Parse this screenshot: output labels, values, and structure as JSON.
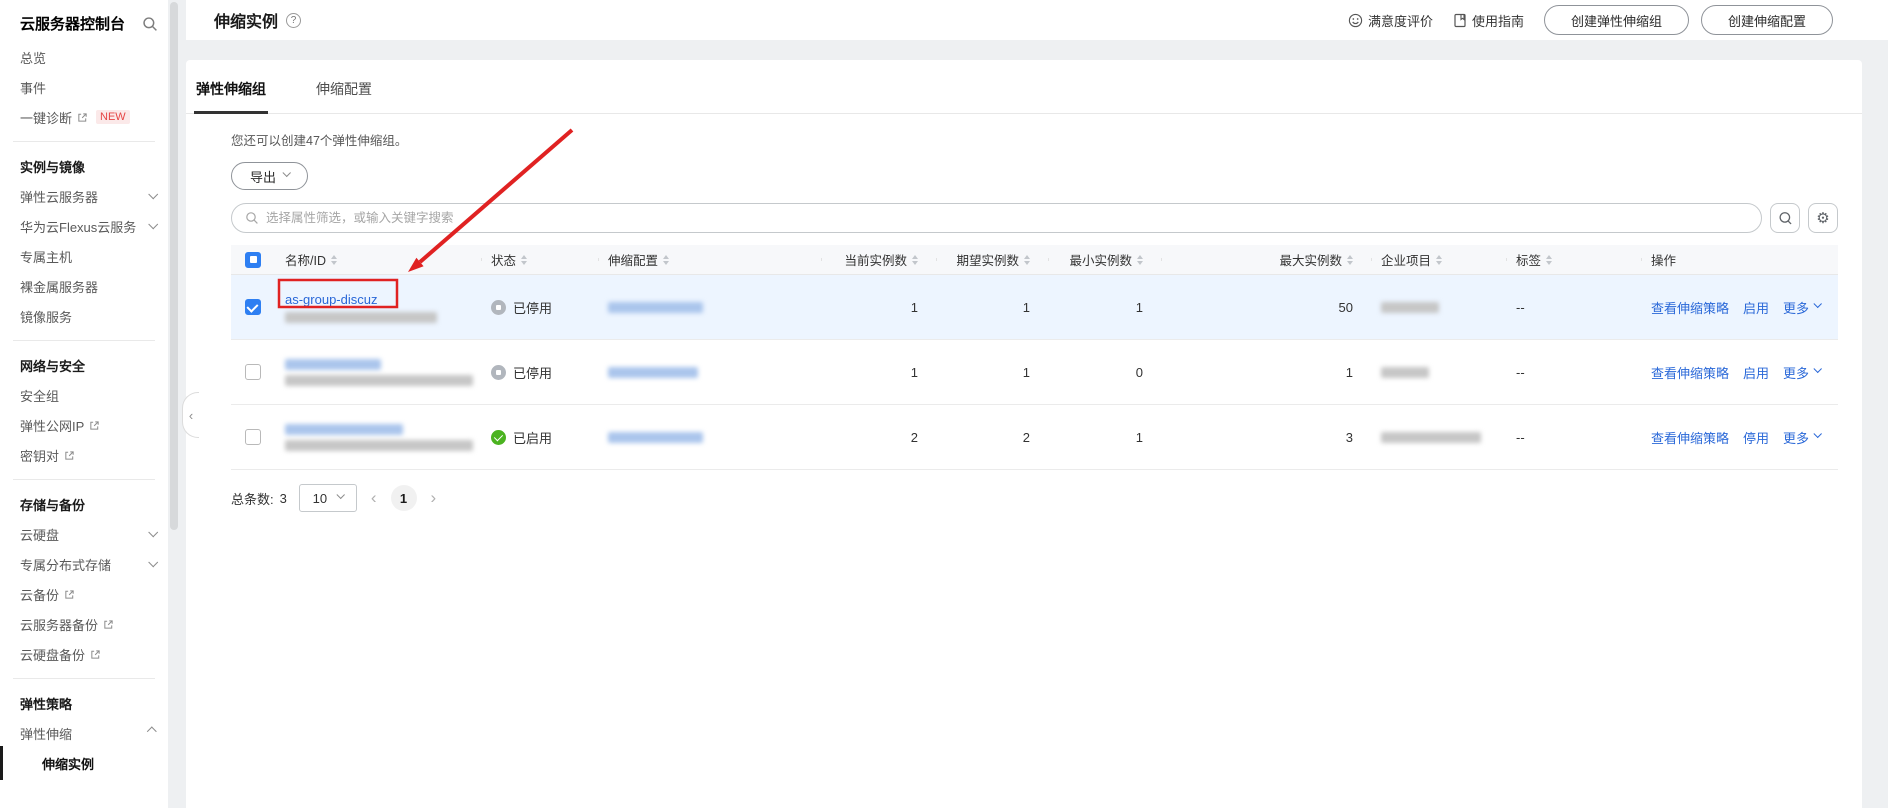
{
  "colors": {
    "link_blue": "#2a68d8",
    "checkbox_blue": "#2e7ff2",
    "status_enabled_green": "#4bb320",
    "status_disabled_grey": "#b1b6bd",
    "active_tab_underline": "#333333",
    "selected_row_bg": "#edf5ff",
    "annotation_red": "#e02222",
    "new_badge_red": "#e64545"
  },
  "sidebar": {
    "title": "云服务器控制台",
    "groups": [
      {
        "items": [
          {
            "label": "总览"
          },
          {
            "label": "事件"
          },
          {
            "label": "一键诊断",
            "badge": "NEW"
          }
        ]
      },
      {
        "header": "实例与镜像",
        "items": [
          {
            "label": "弹性云服务器"
          },
          {
            "label": "华为云Flexus云服务"
          },
          {
            "label": "专属主机"
          },
          {
            "label": "裸金属服务器"
          },
          {
            "label": "镜像服务"
          }
        ]
      },
      {
        "header": "网络与安全",
        "items": [
          {
            "label": "安全组"
          },
          {
            "label": "弹性公网IP"
          },
          {
            "label": "密钥对"
          }
        ]
      },
      {
        "header": "存储与备份",
        "items": [
          {
            "label": "云硬盘"
          },
          {
            "label": "专属分布式存储"
          },
          {
            "label": "云备份"
          },
          {
            "label": "云服务器备份"
          },
          {
            "label": "云硬盘备份"
          }
        ]
      },
      {
        "header": "弹性策略",
        "items": [
          {
            "label": "弹性伸缩"
          },
          {
            "label": "伸缩实例"
          }
        ]
      }
    ]
  },
  "topbar": {
    "title": "伸缩实例",
    "feedback_label": "满意度评价",
    "guide_label": "使用指南",
    "create_group_label": "创建弹性伸缩组",
    "create_config_label": "创建伸缩配置"
  },
  "tabs": {
    "active": "弹性伸缩组",
    "inactive": "伸缩配置"
  },
  "quota_note": "您还可以创建47个弹性伸缩组。",
  "export_label": "导出",
  "filter": {
    "placeholder": "选择属性筛选，或输入关键字搜索"
  },
  "table": {
    "columns": [
      "名称/ID",
      "状态",
      "伸缩配置",
      "当前实例数",
      "期望实例数",
      "最小实例数",
      "最大实例数",
      "企业项目",
      "标签",
      "操作"
    ],
    "rows": [
      {
        "name": "as-group-discuz",
        "status": "已停用",
        "current": "1",
        "desired": "1",
        "min": "1",
        "max": "50",
        "tags": "--",
        "action_view": "查看伸缩策略",
        "action_toggle": "启用",
        "action_more": "更多"
      },
      {
        "status": "已停用",
        "current": "1",
        "desired": "1",
        "min": "0",
        "max": "1",
        "tags": "--",
        "action_view": "查看伸缩策略",
        "action_toggle": "启用",
        "action_more": "更多"
      },
      {
        "status": "已启用",
        "current": "2",
        "desired": "2",
        "min": "1",
        "max": "3",
        "tags": "--",
        "action_view": "查看伸缩策略",
        "action_toggle": "停用",
        "action_more": "更多"
      }
    ]
  },
  "pagination": {
    "total_label": "总条数:",
    "total": "3",
    "page_size": "10",
    "current_page": "1"
  }
}
